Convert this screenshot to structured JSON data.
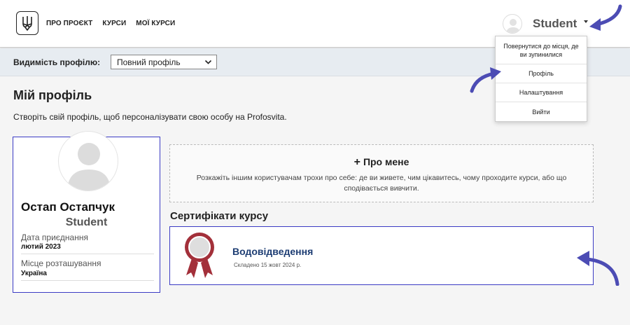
{
  "header": {
    "nav": [
      "ПРО ПРОЄКТ",
      "КУРСИ",
      "МОЇ КУРСИ"
    ],
    "user_name": "Student"
  },
  "dropdown": {
    "items": [
      "Повернутися до місця, де ви зупинилися",
      "Профіль",
      "Налаштування",
      "Вийти"
    ]
  },
  "visibility": {
    "label": "Видимість профілю:",
    "selected": "Повний профіль"
  },
  "page": {
    "title": "Мій профіль",
    "subtitle": "Створіть свій профіль, щоб персоналізувати свою особу на Profosvita."
  },
  "profile": {
    "full_name": "Остап Остапчук",
    "username": "Student",
    "joined_label": "Дата приєднання",
    "joined_value": "лютий 2023",
    "location_label": "Місце розташування",
    "location_value": "Україна"
  },
  "about": {
    "title": "Про мене",
    "text": "Розкажіть іншим користувачам трохи про себе: де ви живете, чим цікавитесь, чому проходите курси, або що сподівається вивчити."
  },
  "certificates": {
    "title": "Сертифікати курсу",
    "items": [
      {
        "name": "Водовідведення",
        "date": "Складено 15 жовт 2024 р."
      }
    ]
  },
  "colors": {
    "accent_border": "#3b3bc4",
    "arrow": "#4c4cb4",
    "ribbon": "#a3303a",
    "cert_link": "#1d3d73"
  }
}
